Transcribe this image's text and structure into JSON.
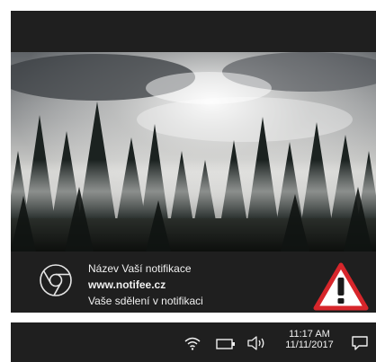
{
  "notification": {
    "title": "Název Vaší notifikace",
    "site": "www.notifee.cz",
    "message": "Vaše sdělení v notifikaci"
  },
  "icons": {
    "app": "chrome-icon",
    "alert": "warning-triangle-icon",
    "wifi": "wifi-icon",
    "battery": "battery-icon",
    "volume": "volume-icon",
    "action_center": "action-center-icon"
  },
  "taskbar": {
    "time": "11:17 AM",
    "date": "11/11/2017"
  },
  "colors": {
    "background_dark": "#1f1f1f",
    "alert_red": "#d7262b",
    "text_light": "#f0f0f0"
  }
}
